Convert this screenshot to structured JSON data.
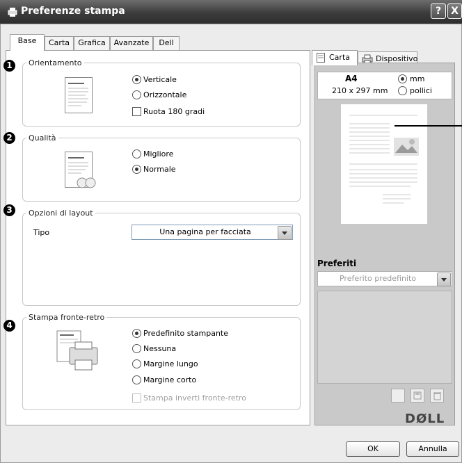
{
  "window": {
    "title": "Preferenze stampa",
    "help_label": "?",
    "close_label": "X"
  },
  "tabs": [
    "Base",
    "Carta",
    "Grafica",
    "Avanzate",
    "Dell"
  ],
  "orientation": {
    "number": "1",
    "legend": "Orientamento",
    "options": [
      "Verticale",
      "Orizzontale"
    ],
    "selected": "Verticale",
    "rotate_label": "Ruota 180 gradi"
  },
  "quality": {
    "number": "2",
    "legend": "Qualità",
    "options": [
      "Migliore",
      "Normale"
    ],
    "selected": "Normale"
  },
  "layout": {
    "number": "3",
    "legend": "Opzioni di layout",
    "type_label": "Tipo",
    "type_value": "Una pagina per facciata"
  },
  "duplex": {
    "number": "4",
    "legend": "Stampa fronte-retro",
    "options": [
      "Predefinito stampante",
      "Nessuna",
      "Margine lungo",
      "Margine corto"
    ],
    "selected": "Predefinito stampante",
    "reverse_label": "Stampa inverti fronte-retro"
  },
  "preview": {
    "tabs": [
      "Carta",
      "Dispositivo"
    ],
    "paper_size": "A4",
    "paper_dims": "210 x 297 mm",
    "units": [
      "mm",
      "pollici"
    ],
    "unit_selected": "mm"
  },
  "favorites": {
    "label": "Preferiti",
    "placeholder": "Preferito predefinito"
  },
  "brand": "DØLL",
  "buttons": {
    "ok": "OK",
    "cancel": "Annulla"
  }
}
